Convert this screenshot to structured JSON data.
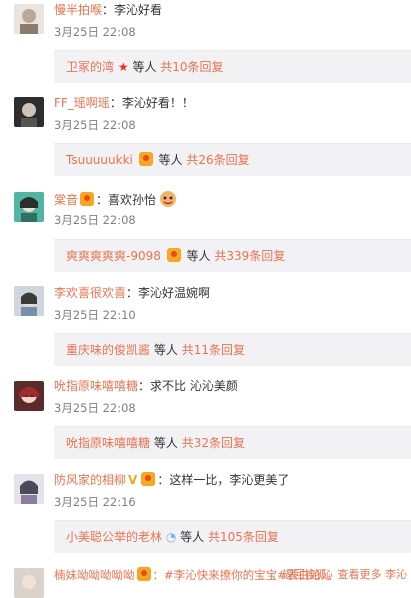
{
  "comments": [
    {
      "user": "慢半拍喉",
      "text": "：李沁好看",
      "time": "3月25日 22:08",
      "reply_user": "卫冢的湾",
      "reply_mid": "等人",
      "reply_count": "共10条回复"
    },
    {
      "user": "FF_瑶啊瑶",
      "text": "：李沁好看！！",
      "time": "3月25日 22:08",
      "reply_user": "Tsuuuuukki",
      "reply_mid": "等人",
      "reply_count": "共26条回复"
    },
    {
      "user": "棠音",
      "text": "：喜欢孙怡",
      "time": "3月25日 22:08",
      "reply_user": "爽爽爽爽爽-9098",
      "reply_mid": "等人",
      "reply_count": "共339条回复"
    },
    {
      "user": "李欢喜很欢喜",
      "text": "：李沁好温婉啊",
      "time": "3月25日 22:10",
      "reply_user": "重庆味的俊凯酱",
      "reply_mid": "等人",
      "reply_count": "共11条回复"
    },
    {
      "user": "吮指原味嘻嘻糖",
      "text": "：求不比 沁沁美颜",
      "time": "3月25日 22:08",
      "reply_user": "吮指原味嘻嘻糖",
      "reply_mid": "等人",
      "reply_count": "共32条回复"
    },
    {
      "user": "防风家的相柳",
      "text": "：这样一比，李沁更美了",
      "time": "3月25日 22:16",
      "reply_user": "小美聪公举的老林",
      "reply_mid": "等人",
      "reply_count": "共105条回复"
    }
  ],
  "last": {
    "user": "楠妹呦呦呦呦呦",
    "text": "：#李沁快来撩你的宝宝#表白沁沁",
    "watermark": "返回搜狐，查看更多 李沁"
  },
  "colors": {
    "link": "#eb7350",
    "reply_bg": "#f2f2f5",
    "time": "#808080"
  }
}
